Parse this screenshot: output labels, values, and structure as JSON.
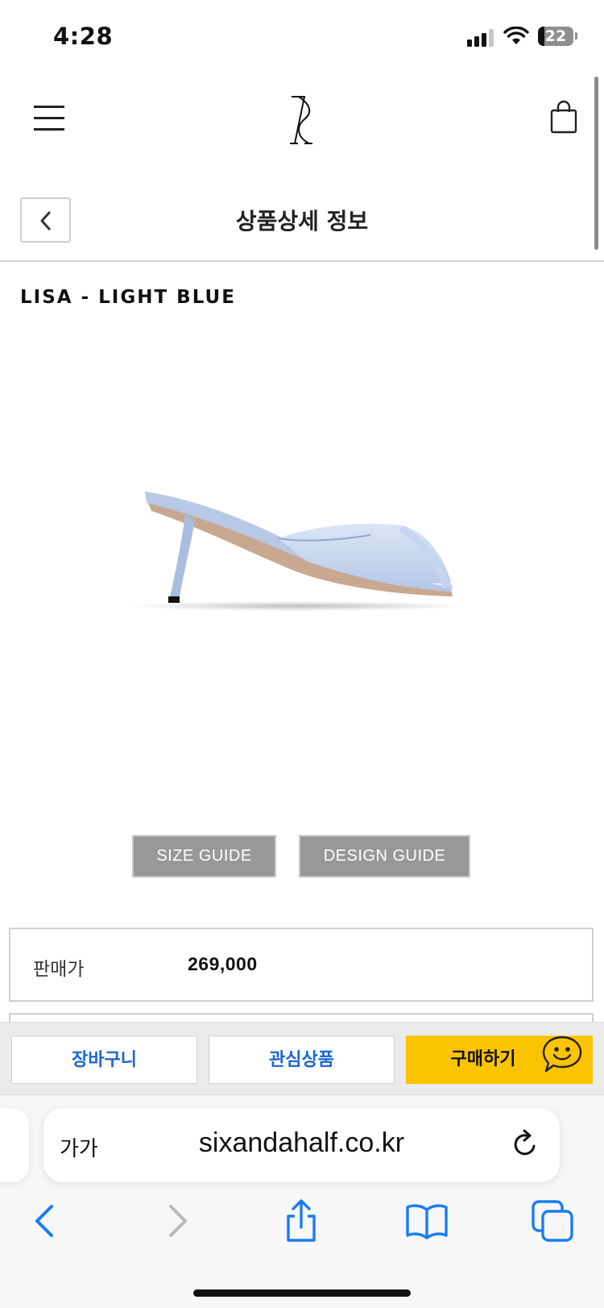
{
  "status_bar": {
    "time": "4:28",
    "battery_level": "22",
    "icons": [
      "signal-icon",
      "wifi-icon",
      "battery-icon"
    ]
  },
  "header": {
    "menu_icon": "hamburger-menu-icon",
    "logo_icon": "sixandahalf-logo-icon",
    "cart_icon": "shopping-bag-icon"
  },
  "sub_header": {
    "back_icon": "chevron-left-icon",
    "title": "상품상세 정보"
  },
  "product": {
    "name": "LISA - LIGHT BLUE",
    "image": "light-blue-mule-sandal",
    "size_guide_label": "SIZE GUIDE",
    "design_guide_label": "DESIGN GUIDE",
    "price_label": "판매가",
    "price_value": "269,000"
  },
  "actions": {
    "cart_label": "장바구니",
    "wishlist_label": "관심상품",
    "buy_label": "구매하기",
    "chat_icon": "smiley-chat-icon",
    "buy_color": "#fbc400",
    "link_color": "#1a66d0"
  },
  "browser": {
    "text_size_label": "가가",
    "url": "sixandahalf.co.kr",
    "reload_icon": "reload-icon",
    "toolbar": [
      "back-icon",
      "forward-icon",
      "share-icon",
      "bookmarks-icon",
      "tabs-icon"
    ],
    "accent_color": "#1a7cf5"
  }
}
